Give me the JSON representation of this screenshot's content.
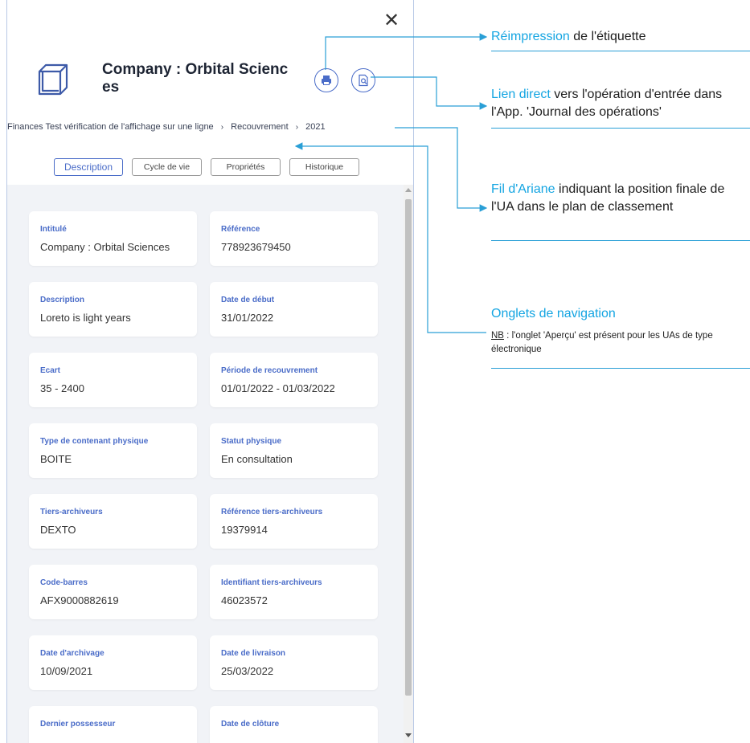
{
  "panel": {
    "close_symbol": "✕",
    "title": "Company : Orbital Sciences",
    "breadcrumb": [
      "Finances Test vérification de l'affichage sur une ligne",
      "Recouvrement",
      "2021"
    ],
    "breadcrumb_separator": "›",
    "tabs": [
      {
        "label": "Description",
        "active": true
      },
      {
        "label": "Cycle de vie",
        "active": false
      },
      {
        "label": "Propriétés",
        "active": false
      },
      {
        "label": "Historique",
        "active": false
      }
    ],
    "fields": [
      {
        "label": "Intitulé",
        "value": "Company : Orbital Sciences"
      },
      {
        "label": "Référence",
        "value": "778923679450"
      },
      {
        "label": "Description",
        "value": "Loreto is light years"
      },
      {
        "label": "Date de début",
        "value": "31/01/2022"
      },
      {
        "label": "Ecart",
        "value": "35 - 2400"
      },
      {
        "label": "Période de recouvrement",
        "value": "01/01/2022 - 01/03/2022"
      },
      {
        "label": "Type de contenant physique",
        "value": "BOITE"
      },
      {
        "label": "Statut physique",
        "value": "En consultation"
      },
      {
        "label": "Tiers-archiveurs",
        "value": "DEXTO"
      },
      {
        "label": "Référence tiers-archiveurs",
        "value": "19379914"
      },
      {
        "label": "Code-barres",
        "value": "AFX9000882619"
      },
      {
        "label": "Identifiant tiers-archiveurs",
        "value": "46023572"
      },
      {
        "label": "Date d'archivage",
        "value": "10/09/2021"
      },
      {
        "label": "Date de livraison",
        "value": "25/03/2022"
      },
      {
        "label": "Dernier possesseur",
        "value": ""
      },
      {
        "label": "Date de clôture",
        "value": ""
      }
    ]
  },
  "annotations": {
    "reprint": {
      "highlight": "Réimpression",
      "rest": " de l'étiquette"
    },
    "direct_link": {
      "highlight": "Lien direct",
      "rest": " vers l'opération d'entrée dans l'App. 'Journal des opérations'"
    },
    "breadcrumb": {
      "highlight": "Fil d'Ariane",
      "rest": " indiquant la position finale de l'UA dans le plan de classement"
    },
    "tabs": {
      "highlight": "Onglets de navigation",
      "note_underlined": "NB",
      "note_rest": " : l'onglet 'Aperçu' est présent pour les UAs de type électronique"
    }
  },
  "colors": {
    "accent": "#4a6cc8",
    "annotation": "#14a5e2",
    "content_bg": "#f1f3f7"
  },
  "icons": {
    "close": "close-icon",
    "box": "box-icon",
    "print": "printer-icon",
    "link": "document-search-icon"
  }
}
